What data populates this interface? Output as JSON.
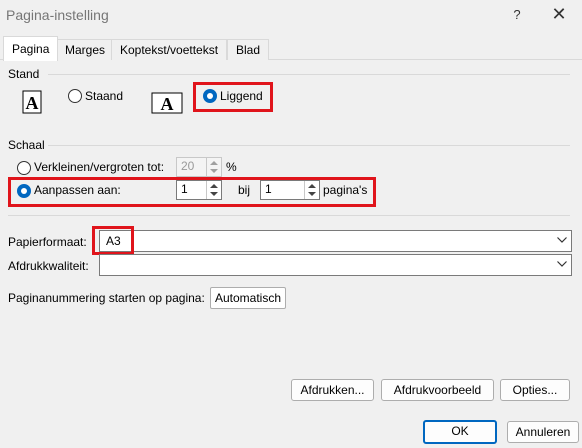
{
  "window": {
    "title": "Pagina-instelling",
    "help": "?",
    "close": "✕"
  },
  "tabs": [
    {
      "label": "Pagina",
      "active": true
    },
    {
      "label": "Marges"
    },
    {
      "label": "Koptekst/voettekst"
    },
    {
      "label": "Blad"
    }
  ],
  "orientation": {
    "group_label": "Stand",
    "portrait_label": "Staand",
    "landscape_label": "Liggend",
    "selected": "landscape",
    "icon_glyph": "A"
  },
  "scale": {
    "group_label": "Schaal",
    "adjust_label": "Verkleinen/vergroten tot:",
    "adjust_value": "20",
    "percent": "%",
    "fit_label": "Aanpassen aan:",
    "fit_wide": "1",
    "by": "bij",
    "fit_tall": "1",
    "pages": "pagina's",
    "selected": "fit"
  },
  "paper": {
    "size_label": "Papierformaat:",
    "size_value": "A3",
    "quality_label": "Afdrukkwaliteit:",
    "quality_value": ""
  },
  "numbering": {
    "label": "Paginanummering starten op pagina:",
    "value": "Automatisch"
  },
  "buttons": {
    "print": "Afdrukken...",
    "preview": "Afdrukvoorbeeld",
    "options": "Opties...",
    "ok": "OK",
    "cancel": "Annuleren"
  },
  "colors": {
    "accent": "#0067c0",
    "highlight": "#e0141b"
  }
}
